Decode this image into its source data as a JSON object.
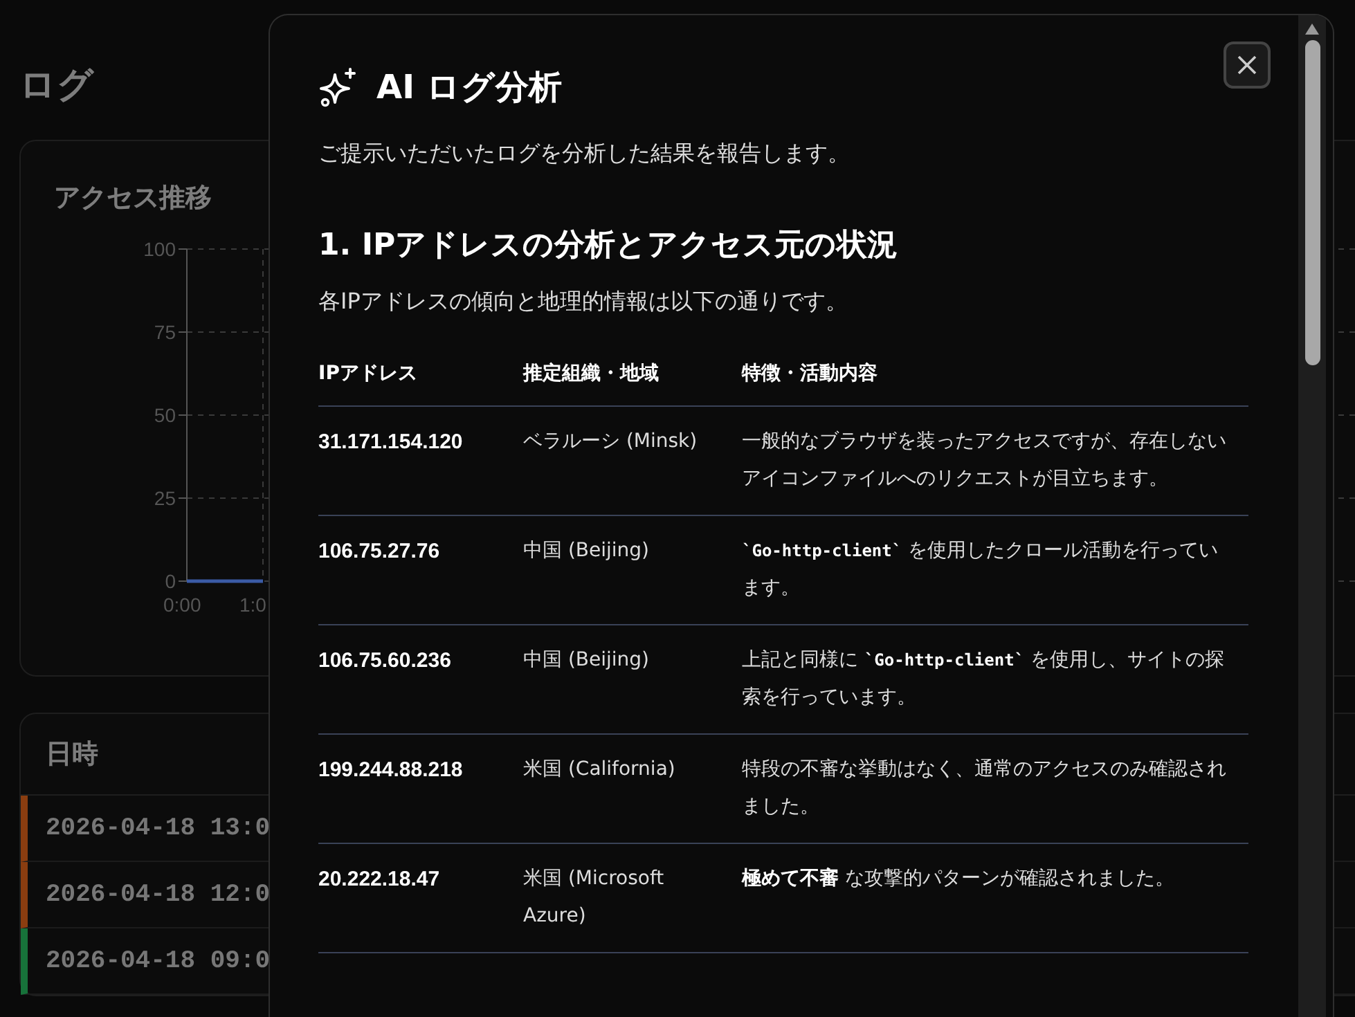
{
  "page": {
    "title": "ログ"
  },
  "chart_card": {
    "title": "アクセス推移",
    "chart_data": {
      "type": "line",
      "categories": [
        "0:00",
        "1:0"
      ],
      "series": [
        {
          "color": "#3b5ba5",
          "values": [
            0,
            0
          ]
        }
      ],
      "ylim": [
        0,
        100
      ],
      "grid": true,
      "yticks": [
        0,
        25,
        50,
        75,
        100
      ]
    }
  },
  "log_table": {
    "columns": [
      "日時"
    ],
    "rows": [
      {
        "datetime": "2026-04-18 13:0",
        "color": "#8a3d10"
      },
      {
        "datetime": "2026-04-18 12:0",
        "color": "#8a3d10"
      },
      {
        "datetime": "2026-04-18 09:0",
        "color": "#17723a"
      }
    ]
  },
  "modal": {
    "title": "AI ログ分析",
    "intro": "ご提示いただいたログを分析した結果を報告します。",
    "section_heading": "1. IPアドレスの分析とアクセス元の状況",
    "section_intro": "各IPアドレスの傾向と地理的情報は以下の通りです。",
    "table": {
      "columns": [
        "IPアドレス",
        "推定組織・地域",
        "特徴・活動内容"
      ],
      "rows": [
        {
          "ip": "31.171.154.120",
          "region": "ベラルーシ (Minsk)",
          "description": [
            {
              "kind": "text",
              "text": "一般的なブラウザを装ったアクセスですが、存在しないアイコンファイルへのリクエストが目立ちます。"
            }
          ]
        },
        {
          "ip": "106.75.27.76",
          "region": "中国 (Beijing)",
          "description": [
            {
              "kind": "code",
              "text": "`Go-http-client`"
            },
            {
              "kind": "text",
              "text": " を使用したクロール活動を行っています。"
            }
          ]
        },
        {
          "ip": "106.75.60.236",
          "region": "中国 (Beijing)",
          "description": [
            {
              "kind": "text",
              "text": "上記と同様に "
            },
            {
              "kind": "code",
              "text": "`Go-http-client`"
            },
            {
              "kind": "text",
              "text": " を使用し、サイトの探索を行っています。"
            }
          ]
        },
        {
          "ip": "199.244.88.218",
          "region": "米国 (California)",
          "description": [
            {
              "kind": "text",
              "text": "特段の不審な挙動はなく、通常のアクセスのみ確認されました。"
            }
          ]
        },
        {
          "ip": "20.222.18.47",
          "region": "米国 (Microsoft Azure)",
          "description": [
            {
              "kind": "strong",
              "text": "極めて不審"
            },
            {
              "kind": "text",
              "text": " な攻撃的パターンが確認されました。"
            }
          ]
        }
      ]
    }
  }
}
